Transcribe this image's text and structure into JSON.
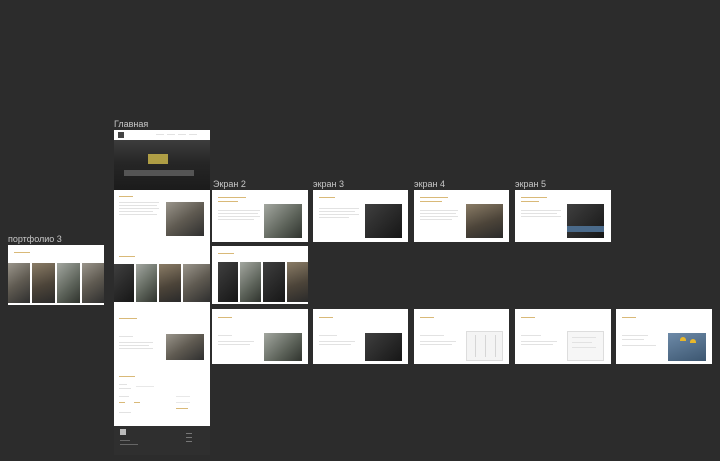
{
  "labels": {
    "main": "Главная",
    "screen2": "Экран 2",
    "screen3": "экран 3",
    "screen4": "экран 4",
    "screen5": "экран 5",
    "portfolio3": "портфолио 3"
  },
  "colors": {
    "canvas": "#2c2c2c",
    "accent_gold": "#c9a25d",
    "footer_dark": "#2f2f2f"
  },
  "icons": {
    "logo": "logo-grid-icon"
  }
}
